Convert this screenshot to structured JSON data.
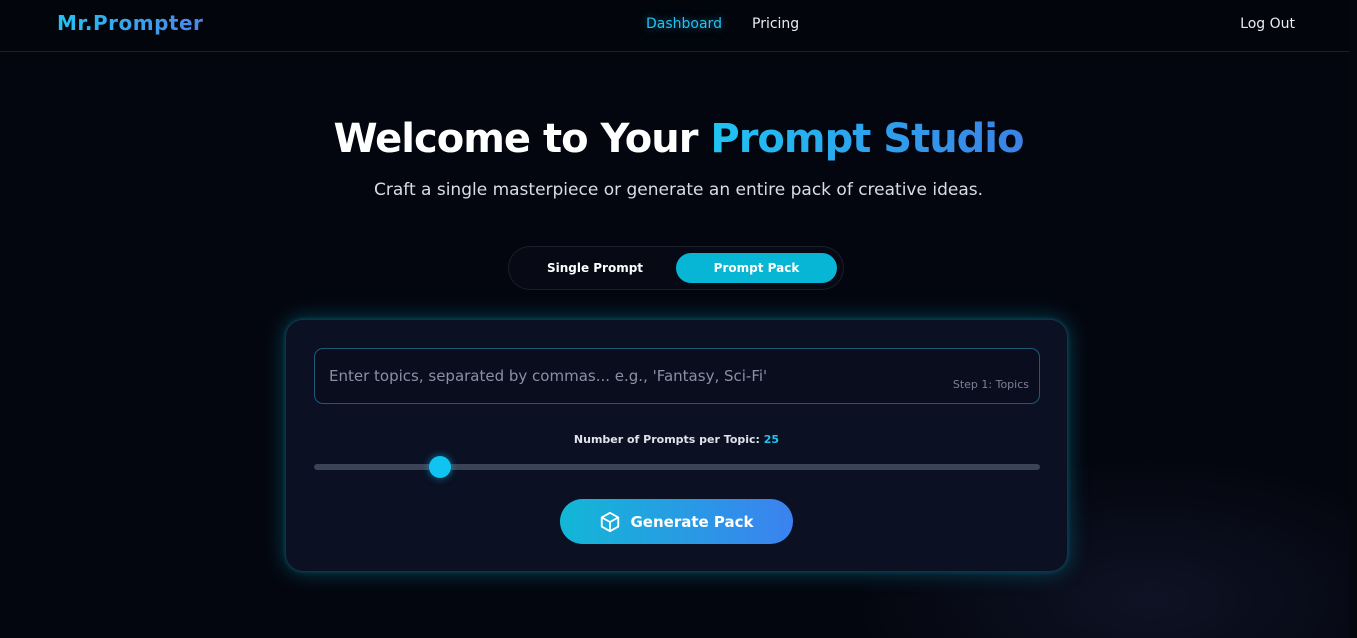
{
  "nav": {
    "brand": "Mr.Prompter",
    "links": [
      "Dashboard",
      "Pricing"
    ],
    "active": "Dashboard",
    "logout": "Log Out"
  },
  "hero": {
    "title_prefix": "Welcome to Your ",
    "title_accent": "Prompt Studio",
    "subtitle": "Craft a single masterpiece or generate an entire pack of creative ideas."
  },
  "mode_toggle": {
    "options": [
      "Single Prompt",
      "Prompt Pack"
    ],
    "selected": "Prompt Pack"
  },
  "form": {
    "topics_placeholder": "Enter topics, separated by commas... e.g., 'Fantasy, Sci-Fi'",
    "topics_value": "",
    "step_label": "Step 1: Topics",
    "slider_label": "Number of Prompts per Topic:",
    "slider_value": "25",
    "generate_label": "Generate Pack",
    "generate_icon": "cube-icon"
  },
  "colors": {
    "accent": "#22c3f0",
    "accent_blue": "#3b82f0",
    "background": "#04060f",
    "card": "#0b1023"
  }
}
